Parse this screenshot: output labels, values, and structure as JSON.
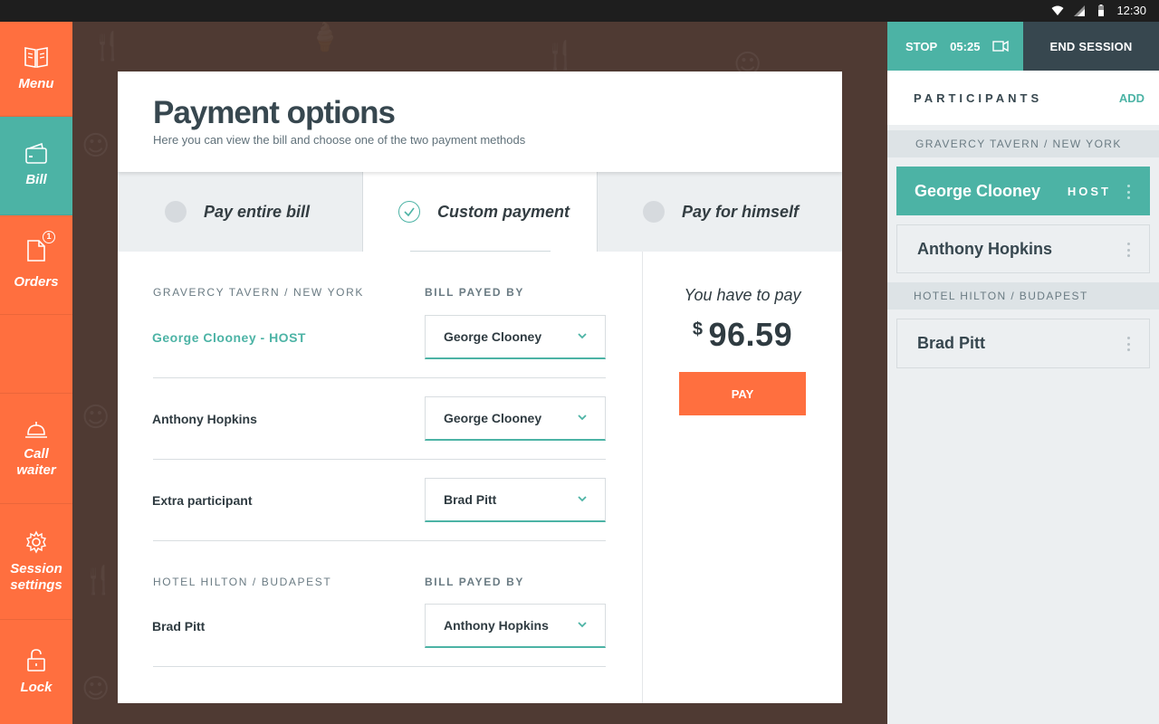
{
  "status_bar": {
    "time": "12:30",
    "icons": [
      "wifi-icon",
      "signal-icon",
      "battery-icon"
    ]
  },
  "nav": {
    "items": [
      {
        "label": "Menu",
        "icon": "book-icon"
      },
      {
        "label": "Bill",
        "icon": "wallet-icon",
        "active": true
      },
      {
        "label": "Orders",
        "icon": "document-icon",
        "badge": "1"
      },
      {
        "label": "",
        "icon": ""
      },
      {
        "label": "Call waiter",
        "icon": "bell-icon"
      },
      {
        "label": "Session settings",
        "icon": "gear-icon"
      },
      {
        "label": "Lock",
        "icon": "lock-icon"
      }
    ]
  },
  "card": {
    "title": "Payment options",
    "subtitle": "Here you can view the bill and choose one of the two payment methods",
    "tabs": [
      {
        "label": "Pay entire bill",
        "selected": false
      },
      {
        "label": "Custom payment",
        "selected": true
      },
      {
        "label": "Pay for himself",
        "selected": false
      }
    ],
    "groups": [
      {
        "venue": "GRAVERCY TAVERN / NEW YORK",
        "column_label": "BILL PAYED BY",
        "rows": [
          {
            "name": "George Clooney - HOST",
            "payer": "George Clooney"
          },
          {
            "name": "Anthony Hopkins",
            "payer": "George Clooney"
          },
          {
            "name": "Extra participant",
            "payer": "Brad Pitt"
          }
        ]
      },
      {
        "venue": "HOTEL HILTON / BUDAPEST",
        "column_label": "BILL PAYED BY",
        "rows": [
          {
            "name": "Brad Pitt",
            "payer": "Anthony Hopkins"
          }
        ]
      }
    ],
    "summary": {
      "label": "You have to pay",
      "currency": "$",
      "amount": "96.59",
      "pay_label": "PAY"
    }
  },
  "session": {
    "stop_label": "STOP",
    "timer": "05:25",
    "end_label": "END SESSION",
    "participants_title": "PARTICIPANTS",
    "add_label": "ADD",
    "venues": [
      {
        "name": "GRAVERCY TAVERN / NEW YORK",
        "people": [
          {
            "name": "George Clooney",
            "tag": "HOST"
          },
          {
            "name": "Anthony Hopkins",
            "tag": ""
          }
        ]
      },
      {
        "name": "HOTEL HILTON / BUDAPEST",
        "people": [
          {
            "name": "Brad Pitt",
            "tag": ""
          }
        ]
      }
    ]
  },
  "colors": {
    "accent": "#4cb3a5",
    "brand": "#ff6f3f",
    "dark": "#37474f",
    "background": "#4f3a33"
  }
}
